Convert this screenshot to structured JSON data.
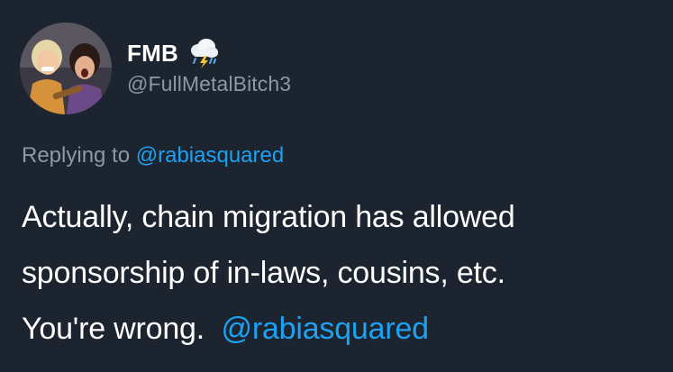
{
  "tweet": {
    "display_name": "FMB",
    "name_emoji_icon": "thunder-cloud-rain-icon",
    "handle": "@FullMetalBitch3",
    "reply_prefix": "Replying to",
    "reply_mention": "@rabiasquared",
    "body_line_1": "Actually, chain migration has allowed",
    "body_line_2": "sponsorship of in-laws, cousins, etc.",
    "body_line_3_text": "You're wrong.",
    "body_line_3_mention": "@rabiasquared"
  },
  "colors": {
    "background": "#1c2430",
    "text_primary": "#ffffff",
    "text_secondary": "#8b98a5",
    "link": "#1da1f2"
  }
}
